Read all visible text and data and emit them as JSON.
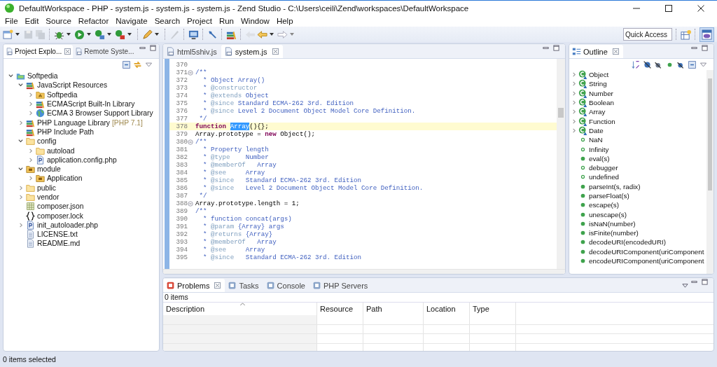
{
  "window": {
    "title": "DefaultWorkspace - PHP - system.js - system.js - system.js - Zend Studio - C:\\Users\\ceili\\Zend\\workspaces\\DefaultWorkspace"
  },
  "menu": [
    "File",
    "Edit",
    "Source",
    "Refactor",
    "Navigate",
    "Search",
    "Project",
    "Run",
    "Window",
    "Help"
  ],
  "quick_access": {
    "placeholder": "Quick Access"
  },
  "explorer": {
    "tabs": [
      {
        "label": "Project Explo...",
        "selected": true
      },
      {
        "label": "Remote Syste...",
        "selected": false
      }
    ],
    "tree": [
      {
        "label": "Softpedia",
        "kind": "project",
        "expanded": true,
        "children": [
          {
            "label": "JavaScript Resources",
            "kind": "library",
            "expanded": true,
            "children": [
              {
                "label": "Softpedia",
                "kind": "jsfolder",
                "expanded": false
              },
              {
                "label": "ECMAScript Built-In Library",
                "kind": "library",
                "expanded": false
              },
              {
                "label": "ECMA 3 Browser Support Library",
                "kind": "globe",
                "expanded": false
              }
            ]
          },
          {
            "label": "PHP Language Library",
            "decoration": "[PHP 7.1]",
            "kind": "library",
            "expanded": false
          },
          {
            "label": "PHP Include Path",
            "kind": "library"
          },
          {
            "label": "config",
            "kind": "folder",
            "expanded": true,
            "children": [
              {
                "label": "autoload",
                "kind": "folder",
                "expanded": false
              },
              {
                "label": "application.config.php",
                "kind": "phpfile",
                "expanded": false
              }
            ]
          },
          {
            "label": "module",
            "kind": "package",
            "expanded": true,
            "children": [
              {
                "label": "Application",
                "kind": "package",
                "expanded": false
              }
            ]
          },
          {
            "label": "public",
            "kind": "folder",
            "expanded": false
          },
          {
            "label": "vendor",
            "kind": "folder",
            "expanded": false
          },
          {
            "label": "composer.json",
            "kind": "jsonfile"
          },
          {
            "label": "composer.lock",
            "kind": "lockfile"
          },
          {
            "label": "init_autoloader.php",
            "kind": "phpfile",
            "expanded": false
          },
          {
            "label": "LICENSE.txt",
            "kind": "textfile"
          },
          {
            "label": "README.md",
            "kind": "textfile"
          }
        ]
      }
    ]
  },
  "editor": {
    "tabs": [
      {
        "label": "html5shiv.js",
        "selected": false
      },
      {
        "label": "system.js",
        "selected": true
      }
    ],
    "lines": [
      {
        "number": "370",
        "fold": false,
        "current": false
      },
      {
        "number": "371",
        "fold": true,
        "current": false,
        "segments": [
          {
            "kind": "doc",
            "text": "/**"
          }
        ]
      },
      {
        "number": "372",
        "fold": false,
        "current": false,
        "segments": [
          {
            "kind": "doc",
            "text": "  * Object Array()"
          }
        ]
      },
      {
        "number": "373",
        "fold": false,
        "current": false,
        "segments": [
          {
            "kind": "doc",
            "text": "  * "
          },
          {
            "kind": "tag",
            "text": "@constructor"
          }
        ]
      },
      {
        "number": "374",
        "fold": false,
        "current": false,
        "segments": [
          {
            "kind": "doc",
            "text": "  * "
          },
          {
            "kind": "tag",
            "text": "@extends"
          },
          {
            "kind": "doc",
            "text": " Object"
          }
        ]
      },
      {
        "number": "375",
        "fold": false,
        "current": false,
        "segments": [
          {
            "kind": "doc",
            "text": "  * "
          },
          {
            "kind": "tag",
            "text": "@since"
          },
          {
            "kind": "doc",
            "text": " Standard ECMA-262 3rd. Edition"
          }
        ]
      },
      {
        "number": "376",
        "fold": false,
        "current": false,
        "segments": [
          {
            "kind": "doc",
            "text": "  * "
          },
          {
            "kind": "tag",
            "text": "@since"
          },
          {
            "kind": "doc",
            "text": " Level 2 Document Object Model Core Definition."
          }
        ]
      },
      {
        "number": "377",
        "fold": false,
        "current": false,
        "segments": [
          {
            "kind": "doc",
            "text": " */"
          }
        ]
      },
      {
        "number": "378",
        "fold": false,
        "current": true,
        "segments": [
          {
            "kind": "keyword",
            "text": "function "
          },
          {
            "kind": "selection",
            "text": "Array"
          },
          {
            "kind": "plain",
            "text": "(){};"
          }
        ]
      },
      {
        "number": "379",
        "fold": false,
        "current": false,
        "segments": [
          {
            "kind": "plain",
            "text": "Array.prototype = "
          },
          {
            "kind": "keyword",
            "text": "new"
          },
          {
            "kind": "plain",
            "text": " Object();"
          }
        ]
      },
      {
        "number": "380",
        "fold": true,
        "current": false,
        "segments": [
          {
            "kind": "doc",
            "text": "/**"
          }
        ]
      },
      {
        "number": "381",
        "fold": false,
        "current": false,
        "segments": [
          {
            "kind": "doc",
            "text": "  * Property length"
          }
        ]
      },
      {
        "number": "382",
        "fold": false,
        "current": false,
        "segments": [
          {
            "kind": "doc",
            "text": "  * "
          },
          {
            "kind": "tag",
            "text": "@type"
          },
          {
            "kind": "doc",
            "text": "    Number"
          }
        ]
      },
      {
        "number": "383",
        "fold": false,
        "current": false,
        "segments": [
          {
            "kind": "doc",
            "text": "  * "
          },
          {
            "kind": "tag",
            "text": "@memberOf"
          },
          {
            "kind": "doc",
            "text": "   Array"
          }
        ]
      },
      {
        "number": "384",
        "fold": false,
        "current": false,
        "segments": [
          {
            "kind": "doc",
            "text": "  * "
          },
          {
            "kind": "tag",
            "text": "@see"
          },
          {
            "kind": "doc",
            "text": "     Array"
          }
        ]
      },
      {
        "number": "385",
        "fold": false,
        "current": false,
        "segments": [
          {
            "kind": "doc",
            "text": "  * "
          },
          {
            "kind": "tag",
            "text": "@since"
          },
          {
            "kind": "doc",
            "text": "   Standard ECMA-262 3rd. Edition"
          }
        ]
      },
      {
        "number": "386",
        "fold": false,
        "current": false,
        "segments": [
          {
            "kind": "doc",
            "text": "  * "
          },
          {
            "kind": "tag",
            "text": "@since"
          },
          {
            "kind": "doc",
            "text": "   Level 2 Document Object Model Core Definition."
          }
        ]
      },
      {
        "number": "387",
        "fold": false,
        "current": false,
        "segments": [
          {
            "kind": "doc",
            "text": " */"
          }
        ]
      },
      {
        "number": "388",
        "fold": true,
        "current": false,
        "segments": [
          {
            "kind": "plain",
            "text": "Array.prototype.length = 1;"
          }
        ]
      },
      {
        "number": "389",
        "fold": false,
        "current": false,
        "segments": [
          {
            "kind": "doc",
            "text": "/**"
          }
        ]
      },
      {
        "number": "390",
        "fold": false,
        "current": false,
        "segments": [
          {
            "kind": "doc",
            "text": "  * function concat(args)"
          }
        ]
      },
      {
        "number": "391",
        "fold": false,
        "current": false,
        "segments": [
          {
            "kind": "doc",
            "text": "  * "
          },
          {
            "kind": "tag",
            "text": "@param"
          },
          {
            "kind": "doc",
            "text": " {Array} args"
          }
        ]
      },
      {
        "number": "392",
        "fold": false,
        "current": false,
        "segments": [
          {
            "kind": "doc",
            "text": "  * "
          },
          {
            "kind": "tag",
            "text": "@returns"
          },
          {
            "kind": "doc",
            "text": " {Array}"
          }
        ]
      },
      {
        "number": "393",
        "fold": false,
        "current": false,
        "segments": [
          {
            "kind": "doc",
            "text": "  * "
          },
          {
            "kind": "tag",
            "text": "@memberOf"
          },
          {
            "kind": "doc",
            "text": "   Array"
          }
        ]
      },
      {
        "number": "394",
        "fold": false,
        "current": false,
        "segments": [
          {
            "kind": "doc",
            "text": "  * "
          },
          {
            "kind": "tag",
            "text": "@see"
          },
          {
            "kind": "doc",
            "text": "     Array"
          }
        ]
      },
      {
        "number": "395",
        "fold": false,
        "current": false,
        "segments": [
          {
            "kind": "doc",
            "text": "  * "
          },
          {
            "kind": "tag",
            "text": "@since"
          },
          {
            "kind": "doc",
            "text": "   Standard ECMA-262 3rd. Edition"
          }
        ]
      }
    ]
  },
  "outline": {
    "tabs": [
      {
        "label": "Outline",
        "selected": true
      }
    ],
    "items": [
      {
        "label": "Object",
        "kind": "class",
        "expanded": false
      },
      {
        "label": "String",
        "kind": "class",
        "expanded": false
      },
      {
        "label": "Number",
        "kind": "class",
        "expanded": false
      },
      {
        "label": "Boolean",
        "kind": "class",
        "expanded": false
      },
      {
        "label": "Array",
        "kind": "class",
        "expanded": false
      },
      {
        "label": "Function",
        "kind": "class",
        "expanded": false
      },
      {
        "label": "Date",
        "kind": "class",
        "expanded": false
      },
      {
        "label": "NaN",
        "kind": "field"
      },
      {
        "label": "Infinity",
        "kind": "field"
      },
      {
        "label": "eval(s)",
        "kind": "method"
      },
      {
        "label": "debugger",
        "kind": "field"
      },
      {
        "label": "undefined",
        "kind": "field"
      },
      {
        "label": "parseInt(s, radix)",
        "kind": "method"
      },
      {
        "label": "parseFloat(s)",
        "kind": "method"
      },
      {
        "label": "escape(s)",
        "kind": "method"
      },
      {
        "label": "unescape(s)",
        "kind": "method"
      },
      {
        "label": "isNaN(number)",
        "kind": "method"
      },
      {
        "label": "isFinite(number)",
        "kind": "method"
      },
      {
        "label": "decodeURI(encodedURI)",
        "kind": "method"
      },
      {
        "label": "decodeURIComponent(uriComponent",
        "kind": "method"
      },
      {
        "label": "encodeURIComponent(uriComponent",
        "kind": "method"
      }
    ]
  },
  "problems": {
    "tabs": [
      {
        "label": "Problems",
        "selected": true
      },
      {
        "label": "Tasks",
        "selected": false
      },
      {
        "label": "Console",
        "selected": false
      },
      {
        "label": "PHP Servers",
        "selected": false
      }
    ],
    "summary": "0 items",
    "columns": [
      {
        "label": "Description",
        "sorted": true
      },
      {
        "label": "Resource",
        "sorted": false
      },
      {
        "label": "Path",
        "sorted": false
      },
      {
        "label": "Location",
        "sorted": false
      },
      {
        "label": "Type",
        "sorted": false
      }
    ]
  },
  "status_bar": "0 items selected"
}
